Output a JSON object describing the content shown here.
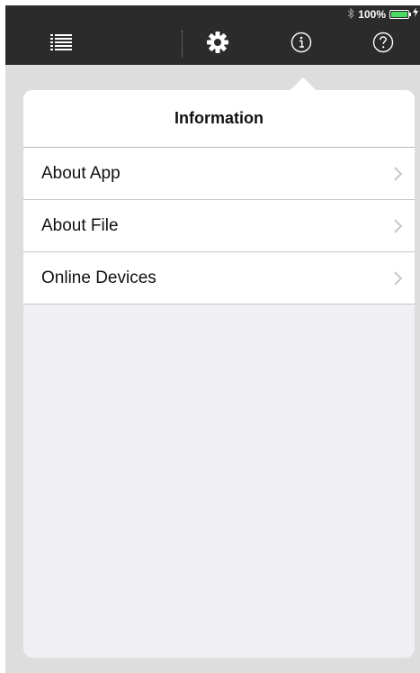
{
  "status_bar": {
    "bluetooth_icon": "bluetooth-icon",
    "battery_percent": "100%",
    "battery_level": 1.0,
    "battery_color": "#4cd964",
    "charging_icon": "lightning-icon"
  },
  "toolbar": {
    "items": [
      {
        "icon": "list-icon"
      },
      {
        "icon": "gear-icon"
      },
      {
        "icon": "info-icon"
      },
      {
        "icon": "help-icon"
      }
    ],
    "selected": "info-icon"
  },
  "popover": {
    "title": "Information",
    "items": [
      {
        "label": "About App"
      },
      {
        "label": "About File"
      },
      {
        "label": "Online Devices"
      }
    ]
  }
}
